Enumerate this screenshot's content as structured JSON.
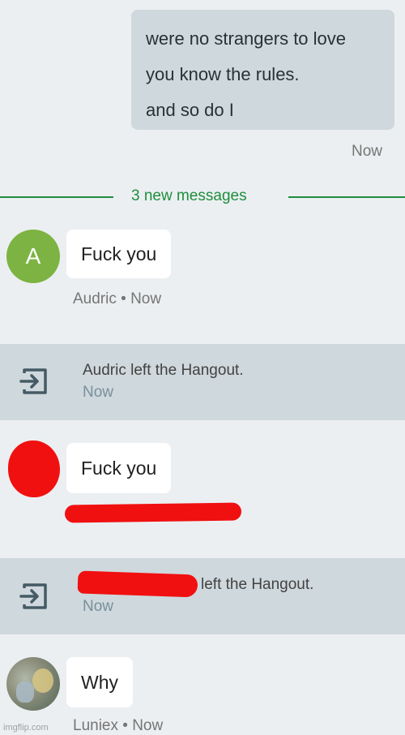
{
  "outgoing": {
    "lines": [
      "were no strangers to love",
      "you know the rules.",
      "and so do I"
    ],
    "time": "Now"
  },
  "divider": {
    "label": "3 new messages"
  },
  "messages": [
    {
      "avatar_letter": "A",
      "text": "Fuck you",
      "meta": "Audric • Now"
    },
    {
      "text": "Fuck you"
    },
    {
      "text": "Why",
      "meta": "Luniex • Now"
    }
  ],
  "system_events": [
    {
      "text": "Audric left the Hangout.",
      "time": "Now"
    },
    {
      "text": "left the Hangout.",
      "time": "Now"
    }
  ],
  "colors": {
    "accent_green": "#1e8e3e",
    "avatar_green": "#7cb342",
    "redaction": "#f01010"
  },
  "icons": {
    "leave": "exit-arrow-icon"
  },
  "watermark": "imgflip.com"
}
